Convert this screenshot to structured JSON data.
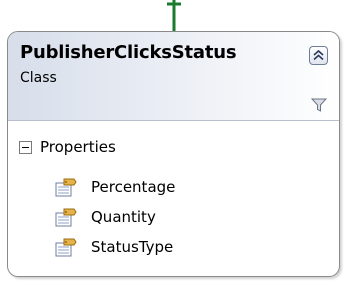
{
  "class_shape": {
    "name": "PublisherClicksStatus",
    "kind": "Class",
    "collapse_icon": "double-chevron-up-icon",
    "filter_icon": "funnel-icon",
    "sections": [
      {
        "label": "Properties",
        "expander_icon": "minus-box-icon",
        "members": [
          {
            "label": "Percentage",
            "icon": "property-icon"
          },
          {
            "label": "Quantity",
            "icon": "property-icon"
          },
          {
            "label": "StatusType",
            "icon": "property-icon"
          }
        ]
      }
    ]
  },
  "colors": {
    "connector": "#1a7a2e",
    "header_start": "#d7deea",
    "border": "#8a8a8a"
  }
}
